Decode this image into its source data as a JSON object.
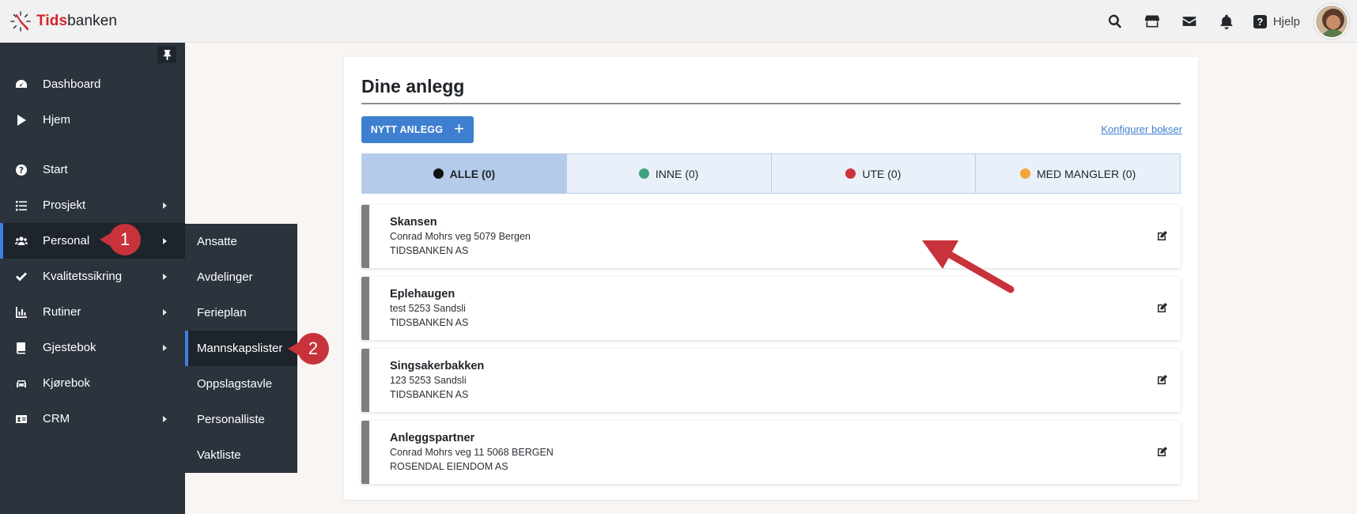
{
  "topbar": {
    "logo_brand_red": "Tids",
    "logo_brand_dark": "banken",
    "icons": [
      "search-icon",
      "store-icon",
      "mail-icon",
      "bell-icon",
      "help-icon"
    ],
    "help_label": "Hjelp"
  },
  "sidebar": {
    "items": [
      {
        "label": "Dashboard",
        "icon": "dashboard-icon",
        "has_submenu": false
      },
      {
        "label": "Hjem",
        "icon": "play-icon",
        "has_submenu": false
      },
      {
        "label": "Start",
        "icon": "question-circle-icon",
        "has_submenu": false
      },
      {
        "label": "Prosjekt",
        "icon": "list-icon",
        "has_submenu": true
      },
      {
        "label": "Personal",
        "icon": "users-icon",
        "has_submenu": true,
        "active": true
      },
      {
        "label": "Kvalitetssikring",
        "icon": "check-icon",
        "has_submenu": true
      },
      {
        "label": "Rutiner",
        "icon": "chart-icon",
        "has_submenu": true
      },
      {
        "label": "Gjestebok",
        "icon": "book-icon",
        "has_submenu": true
      },
      {
        "label": "Kjørebok",
        "icon": "car-icon",
        "has_submenu": false
      },
      {
        "label": "CRM",
        "icon": "id-card-icon",
        "has_submenu": true
      }
    ]
  },
  "submenu": {
    "items": [
      "Ansatte",
      "Avdelinger",
      "Ferieplan",
      "Mannskapslister",
      "Oppslagstavle",
      "Personalliste",
      "Vaktliste"
    ],
    "active": "Mannskapslister"
  },
  "callouts": [
    "1",
    "2"
  ],
  "main": {
    "title": "Dine anlegg",
    "new_button": "NYTT ANLEGG",
    "configure_link": "Konfigurer bokser",
    "tabs": [
      {
        "label": "ALLE (0)",
        "color": "#111111",
        "active": true
      },
      {
        "label": "INNE (0)",
        "color": "#3ea37a"
      },
      {
        "label": "UTE (0)",
        "color": "#d0313a"
      },
      {
        "label": "MED MANGLER (0)",
        "color": "#f4a53a"
      }
    ],
    "sites": [
      {
        "name": "Skansen",
        "address": "Conrad Mohrs veg 5079 Bergen",
        "org": "TIDSBANKEN AS"
      },
      {
        "name": "Eplehaugen",
        "address": "test 5253 Sandsli",
        "org": "TIDSBANKEN AS"
      },
      {
        "name": "Singsakerbakken",
        "address": "123 5253 Sandsli",
        "org": "TIDSBANKEN AS"
      },
      {
        "name": "Anleggspartner",
        "address": "Conrad Mohrs veg 11 5068 BERGEN",
        "org": "ROSENDAL EIENDOM AS"
      }
    ]
  },
  "colors": {
    "sidebar_bg": "#2b333d",
    "accent_blue": "#3f7fcf",
    "callout_red": "#c8323b"
  }
}
